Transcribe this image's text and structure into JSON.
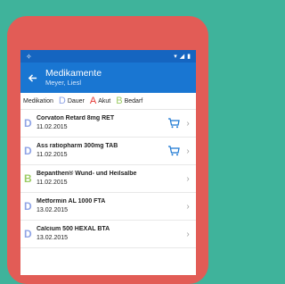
{
  "colors": {
    "background": "#3FB39B",
    "device": "#E25C56",
    "statusbar": "#1565C0",
    "appbar": "#1976D2",
    "dauer": "#90A4E6",
    "akut": "#E53935",
    "bedarf": "#9CCC65"
  },
  "header": {
    "title": "Medikamente",
    "subtitle": "Meyer, Liesl"
  },
  "legend": {
    "label": "Medikation",
    "items": [
      {
        "code": "D",
        "label": "Dauer",
        "color": "#90A4E6"
      },
      {
        "code": "A",
        "label": "Akut",
        "color": "#E53935"
      },
      {
        "code": "B",
        "label": "Bedarf",
        "color": "#9CCC65"
      }
    ]
  },
  "medications": [
    {
      "code": "D",
      "color": "#90A4E6",
      "name": "Corvaton Retard 8mg RET",
      "date": "11.02.2015",
      "cart": true
    },
    {
      "code": "D",
      "color": "#90A4E6",
      "name": "Ass ratiopharm 300mg TAB",
      "date": "11.02.2015",
      "cart": true
    },
    {
      "code": "B",
      "color": "#9CCC65",
      "name": "Bepanthen® Wund- und Heilsalbe",
      "date": "11.02.2015",
      "cart": false
    },
    {
      "code": "D",
      "color": "#90A4E6",
      "name": "Metformin AL 1000 FTA",
      "date": "13.02.2015",
      "cart": false
    },
    {
      "code": "D",
      "color": "#90A4E6",
      "name": "Calcium 500 HEXAL BTA",
      "date": "13.02.2015",
      "cart": false
    }
  ]
}
